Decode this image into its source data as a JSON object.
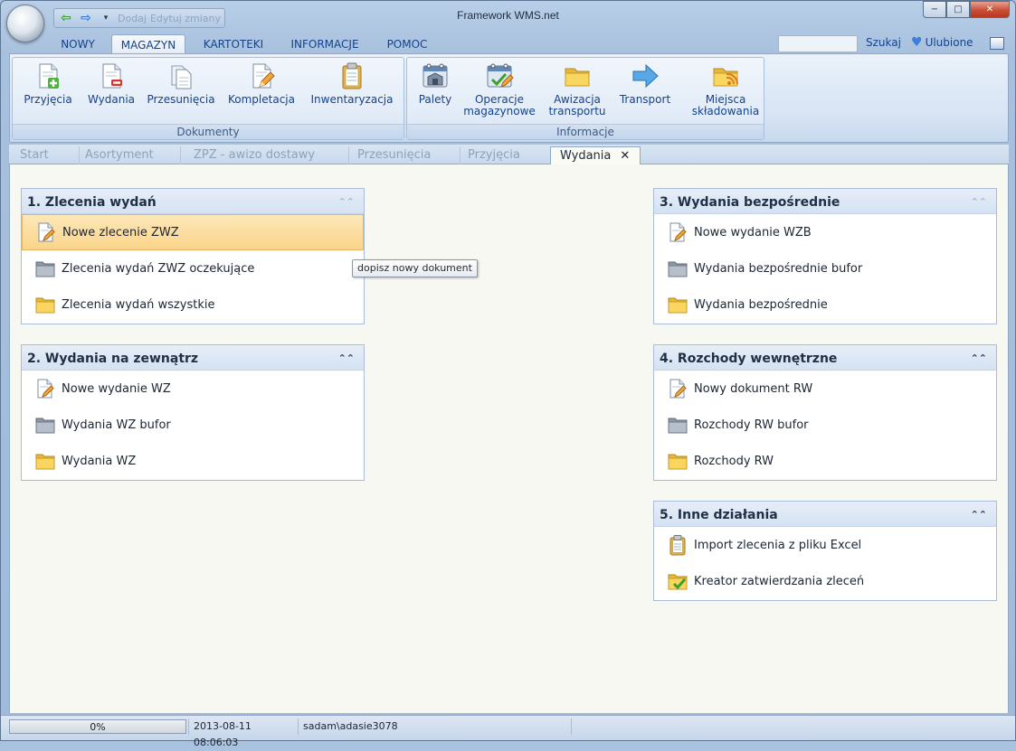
{
  "window": {
    "title": "Framework WMS.net",
    "qat_faded_1": "Dodaj",
    "qat_faded_2": "Edytuj zmiany",
    "minimize": "−",
    "maximize": "□",
    "close": "✕"
  },
  "ribbon_tabs": [
    "NOWY",
    "MAGAZYN",
    "KARTOTEKI",
    "INFORMACJE",
    "POMOC"
  ],
  "ribbon_active_tab": "MAGAZYN",
  "search": {
    "placeholder": "",
    "label": "Szukaj"
  },
  "favorites": {
    "label": "Ulubione"
  },
  "ribbon_groups": [
    {
      "label": "Dokumenty",
      "buttons": [
        {
          "label": "Przyjęcia",
          "icon": "document-add-icon"
        },
        {
          "label": "Wydania",
          "icon": "document-remove-icon"
        },
        {
          "label": "Przesunięcia",
          "icon": "documents-move-icon"
        },
        {
          "label": "Kompletacja",
          "icon": "document-edit-icon"
        },
        {
          "label": "Inwentaryzacja",
          "icon": "clipboard-icon"
        }
      ]
    },
    {
      "label": "Informacje",
      "buttons": [
        {
          "label": "Palety",
          "icon": "pallet-calendar-icon"
        },
        {
          "label_1": "Operacje",
          "label_2": "magazynowe",
          "icon": "operations-calendar-icon"
        },
        {
          "label_1": "Awizacja",
          "label_2": "transportu",
          "icon": "folder-icon"
        },
        {
          "label": "Transport",
          "icon": "arrow-right-icon"
        },
        {
          "label_1": "Miejsca",
          "label_2": "składowania",
          "icon": "storage-folder-icon"
        }
      ]
    }
  ],
  "doc_tabs": [
    "Start",
    "Asortyment",
    "ZPZ - awizo dostawy",
    "Przesunięcia",
    "Przyjęcia",
    "Wydania"
  ],
  "doc_active_tab": "Wydania",
  "panels": {
    "p1": {
      "title": "1. Zlecenia wydań",
      "items": [
        "Nowe zlecenie ZWZ",
        "Zlecenia wydań ZWZ oczekujące",
        "Zlecenia wydań wszystkie"
      ]
    },
    "p2": {
      "title": "2. Wydania na zewnątrz",
      "items": [
        "Nowe wydanie WZ",
        "Wydania WZ bufor",
        "Wydania WZ"
      ]
    },
    "p3": {
      "title": "3. Wydania bezpośrednie",
      "items": [
        "Nowe wydanie WZB",
        "Wydania bezpośrednie bufor",
        "Wydania bezpośrednie"
      ]
    },
    "p4": {
      "title": "4. Rozchody wewnętrzne",
      "items": [
        "Nowy dokument RW",
        "Rozchody RW bufor",
        "Rozchody RW"
      ]
    },
    "p5": {
      "title": "5. Inne działania",
      "items": [
        "Import zlecenia z pliku Excel",
        "Kreator zatwierdzania zleceń"
      ]
    }
  },
  "tooltip": "dopisz nowy dokument",
  "status": {
    "progress_text": "0%",
    "progress_fraction": 0,
    "datetime": "2013-08-11 08:06:03",
    "user": "sadam\\adasie3078"
  },
  "colors": {
    "highlight": "#fbd48a",
    "ribbon_text": "#15428b",
    "folder_yellow": "#f5d04a",
    "folder_gray": "#9aa5b1"
  }
}
